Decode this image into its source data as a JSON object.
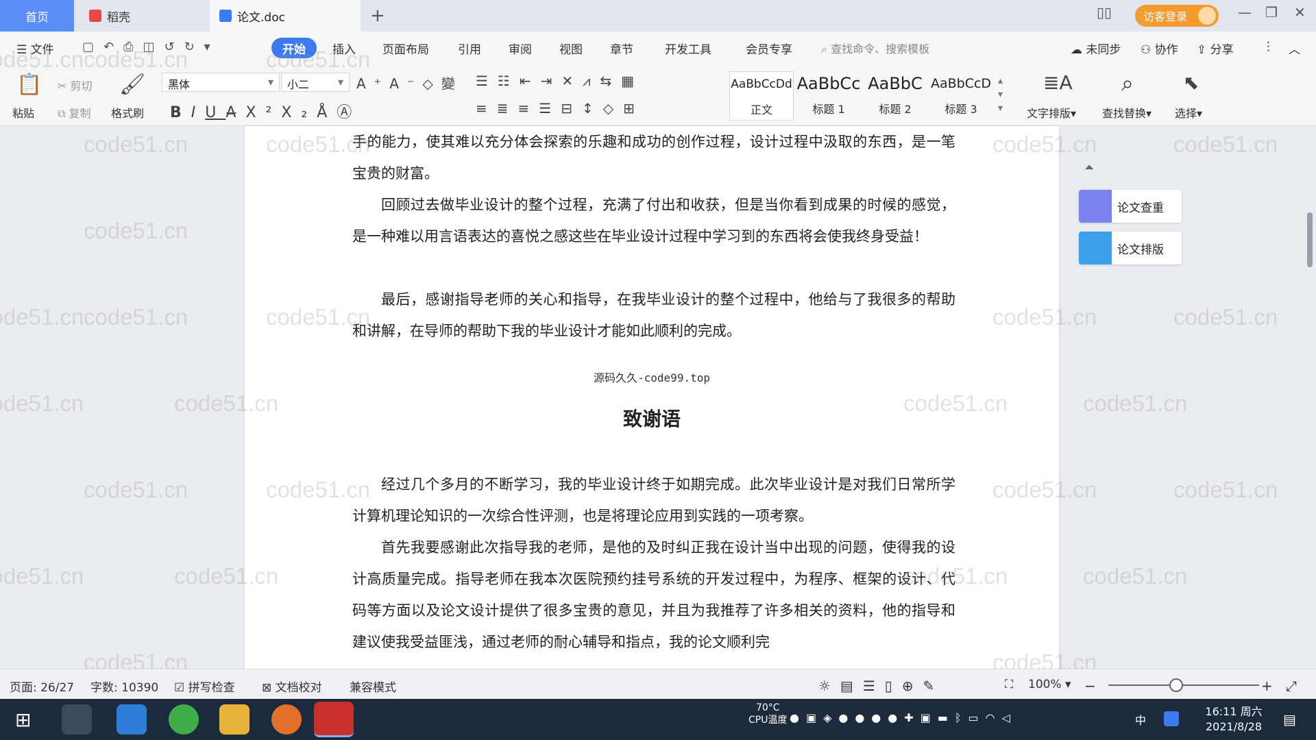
{
  "tabs": {
    "home": "首页",
    "daoke": "稻壳",
    "doc": "论文.doc",
    "add": "+"
  },
  "visitor_login": "访客登录",
  "menu": {
    "file": "文件",
    "start": "开始",
    "items": [
      "插入",
      "页面布局",
      "引用",
      "审阅",
      "视图",
      "章节",
      "开发工具",
      "会员专享"
    ],
    "search_placeholder": "查找命令、搜索模板",
    "unsync": "未同步",
    "collab": "协作",
    "share": "分享"
  },
  "ribbon": {
    "paste": "粘贴",
    "cut": "剪切",
    "copy": "复制",
    "format_painter": "格式刷",
    "font_name": "黑体",
    "font_size": "小二",
    "styles": [
      {
        "preview": "AaBbCcDd",
        "name": "正文"
      },
      {
        "preview": "AaBbCc",
        "name": "标题 1"
      },
      {
        "preview": "AaBbC",
        "name": "标题 2"
      },
      {
        "preview": "AaBbCcD",
        "name": "标题 3"
      }
    ],
    "text_layout": "文字排版",
    "find_replace": "查找替换",
    "select": "选择"
  },
  "document": {
    "paragraphs_top": [
      {
        "text": "手的能力，使其难以充分体会探索的乐趣和成功的创作过程，设计过程中汲取的东西，是一笔宝贵的财富。",
        "indent": false
      },
      {
        "text": "回顾过去做毕业设计的整个过程，充满了付出和收获，但是当你看到成果的时候的感觉，是一种难以用言语表达的喜悦之感这些在毕业设计过程中学习到的东西将会使我终身受益！",
        "indent": true
      },
      {
        "text": "最后，感谢指导老师的关心和指导，在我毕业设计的整个过程中，他给与了我很多的帮助和讲解，在导师的帮助下我的毕业设计才能如此顺利的完成。",
        "indent": true
      }
    ],
    "watermark_line": "源码久久-code99.top",
    "section_title": "致谢语",
    "paragraphs_bottom": [
      {
        "text": "经过几个多月的不断学习，我的毕业设计终于如期完成。此次毕业设计是对我们日常所学计算机理论知识的一次综合性评测，也是将理论应用到实践的一项考察。",
        "indent": true
      },
      {
        "text": "首先我要感谢此次指导我的老师，是他的及时纠正我在设计当中出现的问题，使得我的设计高质量完成。指导老师在我本次医院预约挂号系统的开发过程中，为程序、框架的设计、代码等方面以及论文设计提供了很多宝贵的意见，并且为我推荐了许多相关的资料，他的指导和建议使我受益匪浅，通过老师的耐心辅导和指点，我的论文顺利完",
        "indent": true
      }
    ]
  },
  "side_panel": {
    "check": "论文查重",
    "layout": "论文排版"
  },
  "watermark_text": "code51.cn",
  "statusbar": {
    "page": "页面: 26/27",
    "words": "字数: 10390",
    "spell": "拼写检查",
    "proof": "文档校对",
    "compat": "兼容模式",
    "zoom": "100%"
  },
  "taskbar": {
    "temp": "70°C",
    "cpu": "CPU温度",
    "ime": "中",
    "time": "16:11 周六",
    "date": "2021/8/28"
  },
  "colors": {
    "accent": "#3d7af0",
    "home_tab": "#5b8ef5",
    "visitor": "#f39b2f",
    "taskbar": "#1c2a3d"
  }
}
